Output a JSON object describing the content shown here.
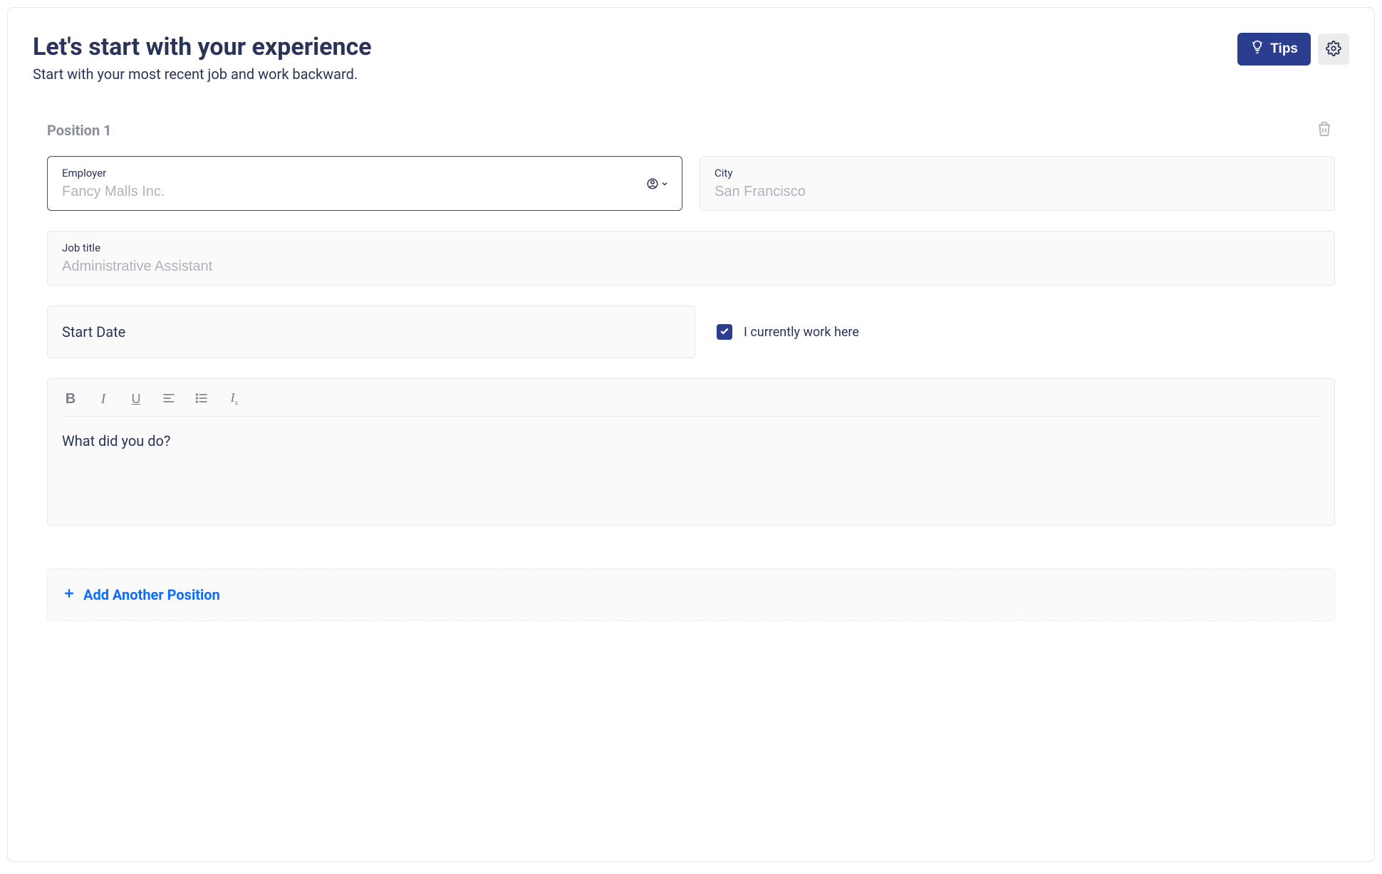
{
  "header": {
    "title": "Let's start with your experience",
    "subtitle": "Start with your most recent job and work backward.",
    "tips_label": "Tips"
  },
  "position": {
    "label": "Position 1",
    "employer": {
      "label": "Employer",
      "placeholder": "Fancy Malls Inc.",
      "value": ""
    },
    "city": {
      "label": "City",
      "placeholder": "San Francisco",
      "value": ""
    },
    "job_title": {
      "label": "Job title",
      "placeholder": "Administrative Assistant",
      "value": ""
    },
    "start_date": {
      "label": "Start Date"
    },
    "currently_work": {
      "label": "I currently work here",
      "checked": true
    },
    "description": {
      "placeholder": "What did you do?"
    }
  },
  "add_button": {
    "label": "Add Another Position"
  }
}
